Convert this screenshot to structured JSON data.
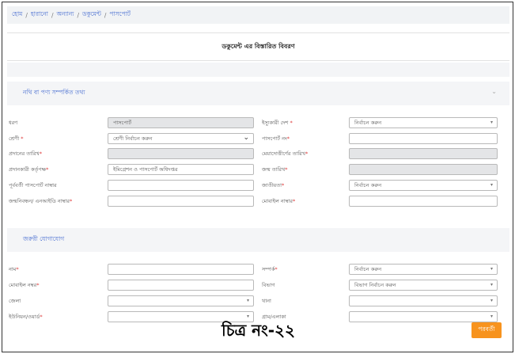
{
  "breadcrumb": {
    "home": "হোম",
    "lost": "হারানো",
    "other": "অন্যান্য",
    "document": "ডকুমেন্ট",
    "current": "পাসপোর্ট"
  },
  "page_title": "ডকুমেন্ট এর বিস্তারিত বিবরণ",
  "doc_section": {
    "title": "নথি বা পণ্য সম্পর্কিত তথ্য",
    "fields": {
      "type_label": "ধরণ",
      "type_value": "পাসপোর্ট",
      "country_label": "ইস্যুকারী দেশ",
      "country_placeholder": "নির্বাচন করুন",
      "class_label": "শ্রেণী",
      "class_value": "শ্রেণী নির্বাচন করুন",
      "passport_no_label": "পাসপোর্ট নং",
      "issue_date_label": "প্রদানের তারিখ",
      "expiry_date_label": "মেয়াদোত্তীর্ণের তারিখ",
      "authority_label": "প্রদানকারী কর্তৃপক্ষ",
      "authority_value": "ইমিগ্রেশন ও পাসপোর্ট অধিদপ্তর",
      "dob_label": "জন্ম তারিখ",
      "prev_passport_label": "পূর্ববর্তী পাসপোর্ট নাম্বার",
      "nationality_label": "জাতীয়তা",
      "nationality_placeholder": "নির্বাচন করুন",
      "nid_label": "জন্মনিবন্ধন/ এনআইডি নাম্বার",
      "mobile_label": "মোবাইল নাম্বার"
    }
  },
  "emergency_section": {
    "title": "জরুরী যোগাযোগ",
    "fields": {
      "name_label": "নাম",
      "relation_label": "সম্পর্ক",
      "relation_placeholder": "নির্বাচন করুন",
      "mobile_label": "মোবাইল নম্বর",
      "division_label": "বিভাগ",
      "division_placeholder": "বিভাগ নির্বাচন করুন",
      "district_label": "জেলা",
      "thana_label": "থানা",
      "union_label": "ইউনিয়ন/ওয়ার্ড",
      "village_label": "গ্রাম/এলাকা"
    }
  },
  "next_button": "পরবর্তী",
  "caption": "চিত্র নং-২২"
}
